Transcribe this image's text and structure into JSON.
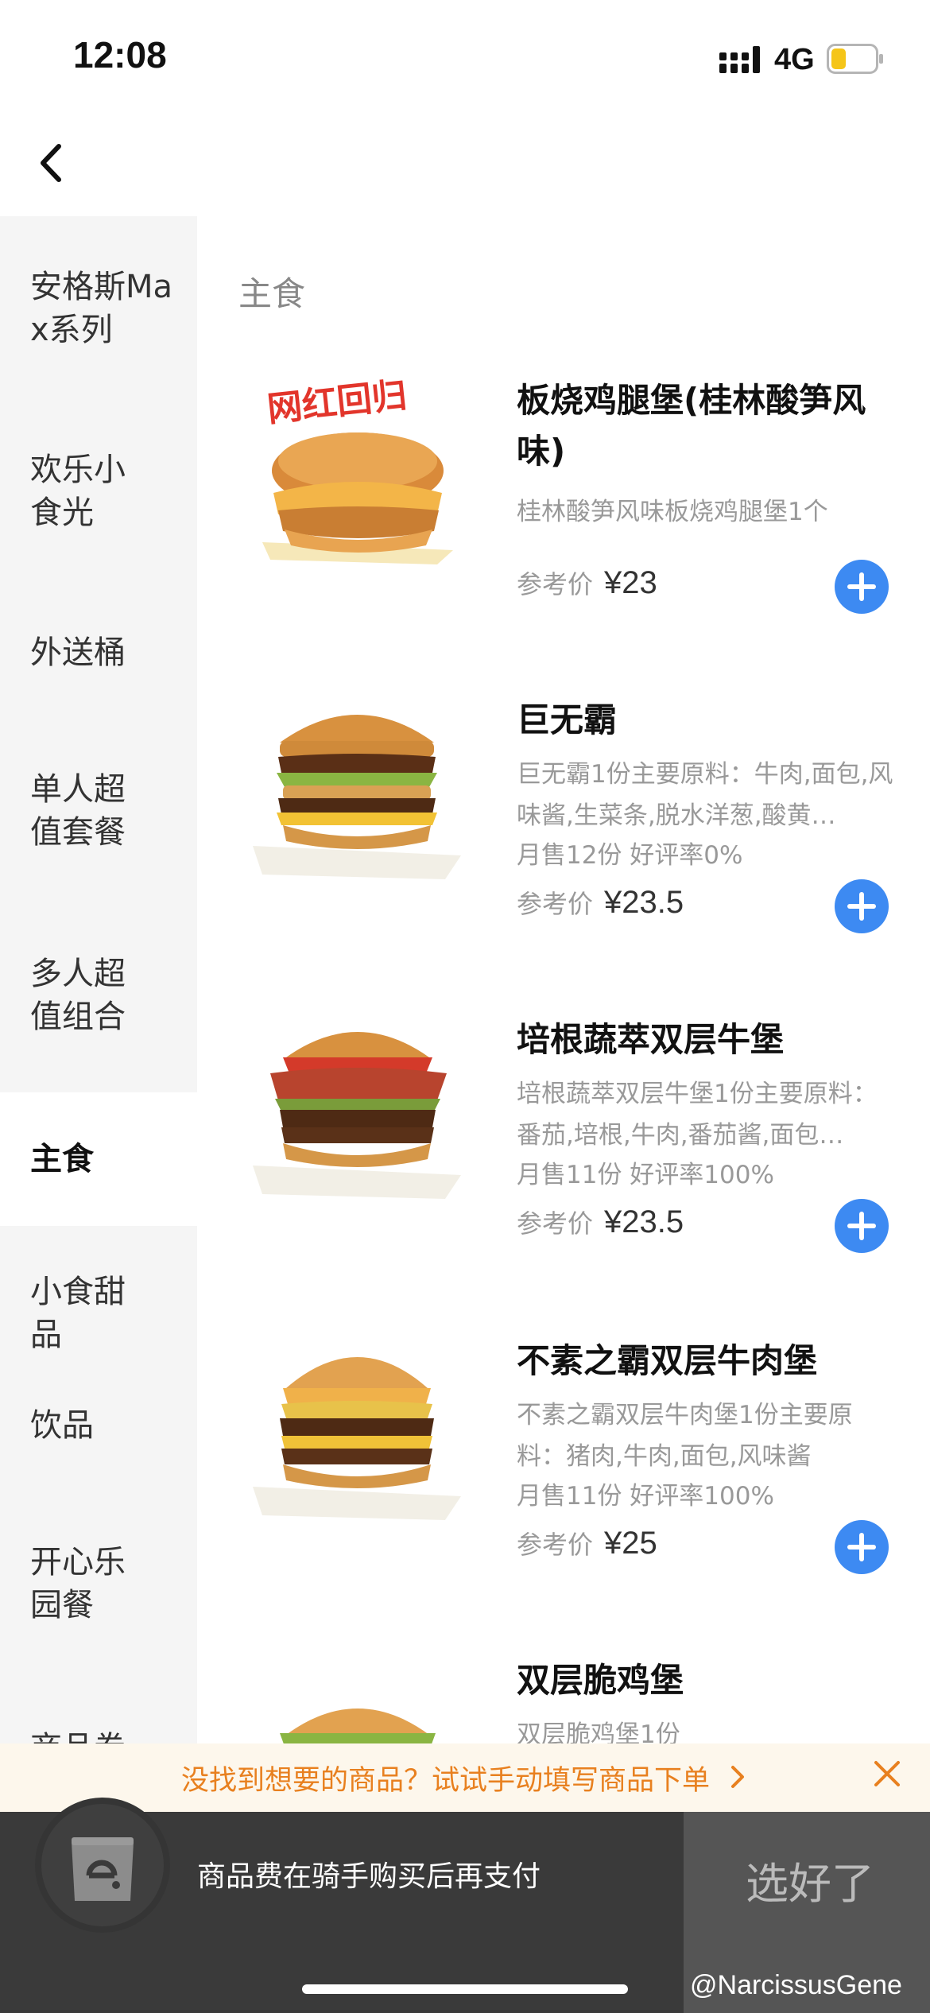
{
  "status_bar": {
    "time": "12:08",
    "network": "4G"
  },
  "sidebar": {
    "items": [
      {
        "label": "安格斯Max系列"
      },
      {
        "label": "欢乐小食光"
      },
      {
        "label": "外送桶"
      },
      {
        "label": "单人超值套餐"
      },
      {
        "label": "多人超值组合"
      },
      {
        "label": "主食"
      },
      {
        "label": "小食甜品"
      },
      {
        "label": "饮品"
      },
      {
        "label": "开心乐园餐"
      },
      {
        "label": "商品卷"
      }
    ],
    "active": "主食"
  },
  "main": {
    "section_title": "主食",
    "price_label": "参考价",
    "products": [
      {
        "name": "板烧鸡腿堡(桂林酸笋风味)",
        "desc": "桂林酸笋风味板烧鸡腿堡1个",
        "stats": "",
        "price": "¥23",
        "badge": "网红回归"
      },
      {
        "name": "巨无霸",
        "desc": "巨无霸1份主要原料：牛肉,面包,风味酱,生菜条,脱水洋葱,酸黄…",
        "stats": "月售12份 好评率0%",
        "price": "¥23.5"
      },
      {
        "name": "培根蔬萃双层牛堡",
        "desc": "培根蔬萃双层牛堡1份主要原料：番茄,培根,牛肉,番茄酱,面包…",
        "stats": "月售11份 好评率100%",
        "price": "¥23.5"
      },
      {
        "name": "不素之霸双层牛肉堡",
        "desc": "不素之霸双层牛肉堡1份主要原料：猪肉,牛肉,面包,风味酱",
        "stats": "月售11份 好评率100%",
        "price": "¥25"
      },
      {
        "name": "双层脆鸡堡",
        "desc": "双层脆鸡堡1份",
        "stats": "",
        "price": ""
      }
    ]
  },
  "tip_bar": {
    "text": "没找到想要的商品？试试手动填写商品下单"
  },
  "cart_bar": {
    "note": "商品费在骑手购买后再支付",
    "done_label": "选好了"
  },
  "watermark": "@NarcissusGene",
  "colors": {
    "accent_blue": "#3d8af2",
    "tip_orange": "#e8801f",
    "cart_dark": "#3a3a3a"
  }
}
